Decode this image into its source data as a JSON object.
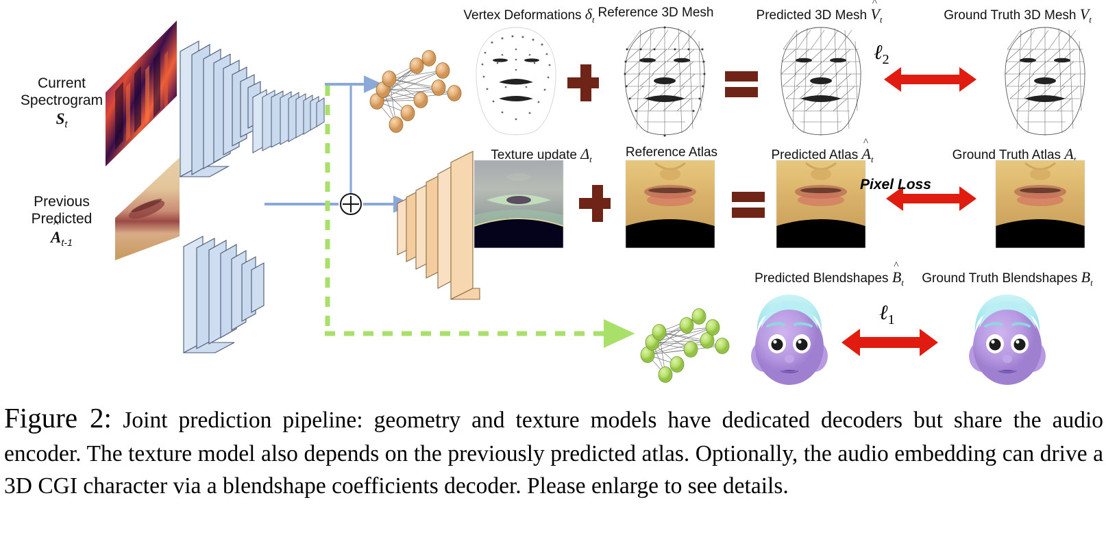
{
  "figure": {
    "id": "Figure 2",
    "caption_label": "Figure 2:",
    "caption_text": "Joint prediction pipeline: geometry and texture models have dedicated decoders but share the audio encoder. The texture model also depends on the previously predicted atlas. Optionally, the audio embedding can drive a 3D CGI character via a blendshape coefficients decoder. Please enlarge to see details."
  },
  "inputs": [
    {
      "id": "spectrogram",
      "line1": "Current",
      "line2": "Spectrogram",
      "symbol": "S",
      "subscript": "t",
      "hat": false
    },
    {
      "id": "previous_atlas",
      "line1": "Previous",
      "line2": "Predicted",
      "symbol": "A",
      "subscript": "t-1",
      "hat": true
    }
  ],
  "operators": {
    "concat": "⊕",
    "plus": "+",
    "equals": "="
  },
  "rows": {
    "geometry": {
      "id": "geometry-row",
      "items": [
        {
          "id": "vertex-deformations",
          "text": "Vertex Deformations",
          "symbol": "δ",
          "subscript": "t",
          "hat": false
        },
        {
          "id": "reference-3d-mesh",
          "text": "Reference 3D Mesh",
          "symbol": "",
          "subscript": "",
          "hat": false
        },
        {
          "id": "predicted-3d-mesh",
          "text": "Predicted 3D Mesh",
          "symbol": "V",
          "subscript": "t",
          "hat": true
        },
        {
          "id": "ground-truth-3d-mesh",
          "text": "Ground Truth 3D Mesh",
          "symbol": "V",
          "subscript": "t",
          "hat": false
        }
      ],
      "loss": {
        "id": "l2-loss",
        "symbol": "ℓ",
        "subscript": "2",
        "style": "math"
      }
    },
    "texture": {
      "id": "texture-row",
      "items": [
        {
          "id": "texture-update",
          "text": "Texture update",
          "symbol": "Δ",
          "subscript": "t",
          "hat": false
        },
        {
          "id": "reference-atlas",
          "text": "Reference Atlas",
          "symbol": "",
          "subscript": "",
          "hat": false
        },
        {
          "id": "predicted-atlas",
          "text": "Predicted Atlas",
          "symbol": "A",
          "subscript": "t",
          "hat": true
        },
        {
          "id": "ground-truth-atlas",
          "text": "Ground Truth Atlas",
          "symbol": "A",
          "subscript": "t",
          "hat": false
        }
      ],
      "loss": {
        "id": "pixel-loss",
        "symbol": "Pixel Loss",
        "subscript": "",
        "style": "text"
      }
    },
    "blendshapes": {
      "id": "blendshapes-row",
      "items": [
        {
          "id": "predicted-blendshapes",
          "text": "Predicted Blendshapes",
          "symbol": "B",
          "subscript": "t",
          "hat": true
        },
        {
          "id": "ground-truth-blendshapes",
          "text": "Ground Truth Blendshapes",
          "symbol": "B",
          "subscript": "t",
          "hat": false
        }
      ],
      "loss": {
        "id": "l1-loss",
        "symbol": "ℓ",
        "subscript": "1",
        "style": "math"
      }
    }
  },
  "colors": {
    "encoder_block": "#c9d9ee",
    "encoder_stroke": "#4a5a74",
    "decoder_block": "#f6d3a8",
    "decoder_stroke": "#8a6a43",
    "arrow_blue": "#8aa8d8",
    "dashed_green": "#a8e06a",
    "node_orange": "#e8b478",
    "node_green": "#b6e06a",
    "loss_arrow_red": "#e01b10",
    "operator_maroon": "#6e2417",
    "cgi_skin": "#b89ae0",
    "cgi_hair": "#aeeaf0"
  }
}
